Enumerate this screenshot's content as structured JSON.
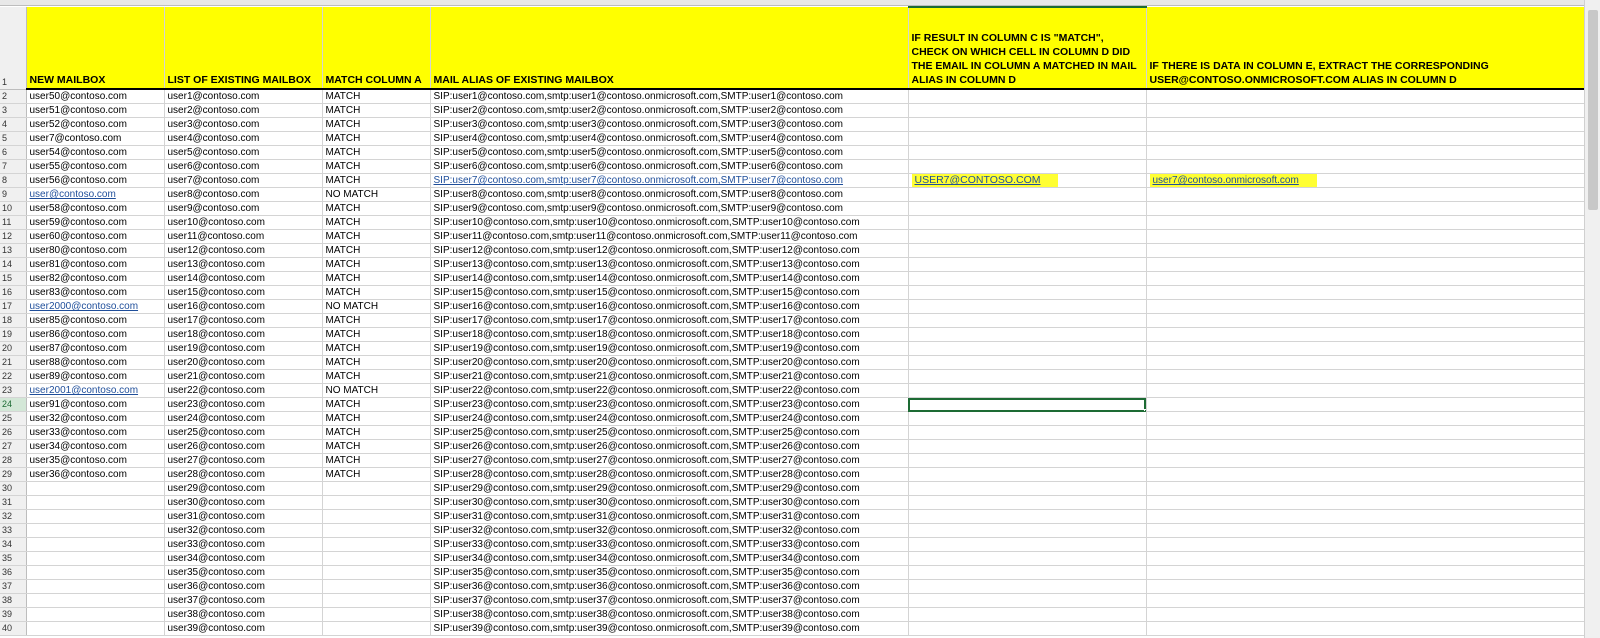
{
  "headers": {
    "a": "NEW MAILBOX",
    "b": "LIST OF EXISTING MAILBOX",
    "c": "MATCH COLUMN A",
    "d": "MAIL ALIAS OF EXISTING MAILBOX",
    "e": "IF RESULT IN COLUMN C IS \"MATCH\", CHECK ON WHICH CELL IN COLUMN D DID THE EMAIL IN COLUMN A MATCHED IN MAIL ALIAS IN COLUMN D",
    "f": "IF THERE IS DATA IN COLUMN E, EXTRACT THE CORRESPONDING USER@CONTOSO.ONMICROSOFT.COM ALIAS IN COLUMN D"
  },
  "rows": [
    {
      "n": "2",
      "a": "user50@contoso.com",
      "b": "user1@contoso.com",
      "c": "MATCH",
      "d": "SIP:user1@contoso.com,smtp:user1@contoso.onmicrosoft.com,SMTP:user1@contoso.com",
      "e": "",
      "f": ""
    },
    {
      "n": "3",
      "a": "user51@contoso.com",
      "b": "user2@contoso.com",
      "c": "MATCH",
      "d": "SIP:user2@contoso.com,smtp:user2@contoso.onmicrosoft.com,SMTP:user2@contoso.com",
      "e": "",
      "f": ""
    },
    {
      "n": "4",
      "a": "user52@contoso.com",
      "b": "user3@contoso.com",
      "c": "MATCH",
      "d": "SIP:user3@contoso.com,smtp:user3@contoso.onmicrosoft.com,SMTP:user3@contoso.com",
      "e": "",
      "f": ""
    },
    {
      "n": "5",
      "a": "user7@contoso.com",
      "b": "user4@contoso.com",
      "c": "MATCH",
      "d": "SIP:user4@contoso.com,smtp:user4@contoso.onmicrosoft.com,SMTP:user4@contoso.com",
      "e": "",
      "f": ""
    },
    {
      "n": "6",
      "a": "user54@contoso.com",
      "b": "user5@contoso.com",
      "c": "MATCH",
      "d": "SIP:user5@contoso.com,smtp:user5@contoso.onmicrosoft.com,SMTP:user5@contoso.com",
      "e": "",
      "f": ""
    },
    {
      "n": "7",
      "a": "user55@contoso.com",
      "b": "user6@contoso.com",
      "c": "MATCH",
      "d": "SIP:user6@contoso.com,smtp:user6@contoso.onmicrosoft.com,SMTP:user6@contoso.com",
      "e": "",
      "f": ""
    },
    {
      "n": "8",
      "a": "user56@contoso.com",
      "b": "user7@contoso.com",
      "c": "MATCH",
      "d": "SIP:user7@contoso.com,smtp:user7@contoso.onmicrosoft.com,SMTP:user7@contoso.com",
      "e": "USER7@CONTOSO.COM",
      "f": "user7@contoso.onmicrosoft.com"
    },
    {
      "n": "9",
      "a": "user@contoso.com",
      "b": "user8@contoso.com",
      "c": "NO MATCH",
      "d": "SIP:user8@contoso.com,smtp:user8@contoso.onmicrosoft.com,SMTP:user8@contoso.com",
      "e": "",
      "f": ""
    },
    {
      "n": "10",
      "a": "user58@contoso.com",
      "b": "user9@contoso.com",
      "c": "MATCH",
      "d": "SIP:user9@contoso.com,smtp:user9@contoso.onmicrosoft.com,SMTP:user9@contoso.com",
      "e": "",
      "f": ""
    },
    {
      "n": "11",
      "a": "user59@contoso.com",
      "b": "user10@contoso.com",
      "c": "MATCH",
      "d": "SIP:user10@contoso.com,smtp:user10@contoso.onmicrosoft.com,SMTP:user10@contoso.com",
      "e": "",
      "f": ""
    },
    {
      "n": "12",
      "a": "user60@contoso.com",
      "b": "user11@contoso.com",
      "c": "MATCH",
      "d": "SIP:user11@contoso.com,smtp:user11@contoso.onmicrosoft.com,SMTP:user11@contoso.com",
      "e": "",
      "f": ""
    },
    {
      "n": "13",
      "a": "user80@contoso.com",
      "b": "user12@contoso.com",
      "c": "MATCH",
      "d": "SIP:user12@contoso.com,smtp:user12@contoso.onmicrosoft.com,SMTP:user12@contoso.com",
      "e": "",
      "f": ""
    },
    {
      "n": "14",
      "a": "user81@contoso.com",
      "b": "user13@contoso.com",
      "c": "MATCH",
      "d": "SIP:user13@contoso.com,smtp:user13@contoso.onmicrosoft.com,SMTP:user13@contoso.com",
      "e": "",
      "f": ""
    },
    {
      "n": "15",
      "a": "user82@contoso.com",
      "b": "user14@contoso.com",
      "c": "MATCH",
      "d": "SIP:user14@contoso.com,smtp:user14@contoso.onmicrosoft.com,SMTP:user14@contoso.com",
      "e": "",
      "f": ""
    },
    {
      "n": "16",
      "a": "user83@contoso.com",
      "b": "user15@contoso.com",
      "c": "MATCH",
      "d": "SIP:user15@contoso.com,smtp:user15@contoso.onmicrosoft.com,SMTP:user15@contoso.com",
      "e": "",
      "f": ""
    },
    {
      "n": "17",
      "a": "user2000@contoso.com",
      "b": "user16@contoso.com",
      "c": "NO MATCH",
      "d": "SIP:user16@contoso.com,smtp:user16@contoso.onmicrosoft.com,SMTP:user16@contoso.com",
      "e": "",
      "f": ""
    },
    {
      "n": "18",
      "a": "user85@contoso.com",
      "b": "user17@contoso.com",
      "c": "MATCH",
      "d": "SIP:user17@contoso.com,smtp:user17@contoso.onmicrosoft.com,SMTP:user17@contoso.com",
      "e": "",
      "f": ""
    },
    {
      "n": "19",
      "a": "user86@contoso.com",
      "b": "user18@contoso.com",
      "c": "MATCH",
      "d": "SIP:user18@contoso.com,smtp:user18@contoso.onmicrosoft.com,SMTP:user18@contoso.com",
      "e": "",
      "f": ""
    },
    {
      "n": "20",
      "a": "user87@contoso.com",
      "b": "user19@contoso.com",
      "c": "MATCH",
      "d": "SIP:user19@contoso.com,smtp:user19@contoso.onmicrosoft.com,SMTP:user19@contoso.com",
      "e": "",
      "f": ""
    },
    {
      "n": "21",
      "a": "user88@contoso.com",
      "b": "user20@contoso.com",
      "c": "MATCH",
      "d": "SIP:user20@contoso.com,smtp:user20@contoso.onmicrosoft.com,SMTP:user20@contoso.com",
      "e": "",
      "f": ""
    },
    {
      "n": "22",
      "a": "user89@contoso.com",
      "b": "user21@contoso.com",
      "c": "MATCH",
      "d": "SIP:user21@contoso.com,smtp:user21@contoso.onmicrosoft.com,SMTP:user21@contoso.com",
      "e": "",
      "f": ""
    },
    {
      "n": "23",
      "a": "user2001@contoso.com",
      "b": "user22@contoso.com",
      "c": "NO MATCH",
      "d": "SIP:user22@contoso.com,smtp:user22@contoso.onmicrosoft.com,SMTP:user22@contoso.com",
      "e": "",
      "f": ""
    },
    {
      "n": "24",
      "a": "user91@contoso.com",
      "b": "user23@contoso.com",
      "c": "MATCH",
      "d": "SIP:user23@contoso.com,smtp:user23@contoso.onmicrosoft.com,SMTP:user23@contoso.com",
      "e": "",
      "f": ""
    },
    {
      "n": "25",
      "a": "user32@contoso.com",
      "b": "user24@contoso.com",
      "c": "MATCH",
      "d": "SIP:user24@contoso.com,smtp:user24@contoso.onmicrosoft.com,SMTP:user24@contoso.com",
      "e": "",
      "f": ""
    },
    {
      "n": "26",
      "a": "user33@contoso.com",
      "b": "user25@contoso.com",
      "c": "MATCH",
      "d": "SIP:user25@contoso.com,smtp:user25@contoso.onmicrosoft.com,SMTP:user25@contoso.com",
      "e": "",
      "f": ""
    },
    {
      "n": "27",
      "a": "user34@contoso.com",
      "b": "user26@contoso.com",
      "c": "MATCH",
      "d": "SIP:user26@contoso.com,smtp:user26@contoso.onmicrosoft.com,SMTP:user26@contoso.com",
      "e": "",
      "f": ""
    },
    {
      "n": "28",
      "a": "user35@contoso.com",
      "b": "user27@contoso.com",
      "c": "MATCH",
      "d": "SIP:user27@contoso.com,smtp:user27@contoso.onmicrosoft.com,SMTP:user27@contoso.com",
      "e": "",
      "f": ""
    },
    {
      "n": "29",
      "a": "user36@contoso.com",
      "b": "user28@contoso.com",
      "c": "MATCH",
      "d": "SIP:user28@contoso.com,smtp:user28@contoso.onmicrosoft.com,SMTP:user28@contoso.com",
      "e": "",
      "f": ""
    },
    {
      "n": "30",
      "a": "",
      "b": "user29@contoso.com",
      "c": "",
      "d": "SIP:user29@contoso.com,smtp:user29@contoso.onmicrosoft.com,SMTP:user29@contoso.com",
      "e": "",
      "f": ""
    },
    {
      "n": "31",
      "a": "",
      "b": "user30@contoso.com",
      "c": "",
      "d": "SIP:user30@contoso.com,smtp:user30@contoso.onmicrosoft.com,SMTP:user30@contoso.com",
      "e": "",
      "f": ""
    },
    {
      "n": "32",
      "a": "",
      "b": "user31@contoso.com",
      "c": "",
      "d": "SIP:user31@contoso.com,smtp:user31@contoso.onmicrosoft.com,SMTP:user31@contoso.com",
      "e": "",
      "f": ""
    },
    {
      "n": "33",
      "a": "",
      "b": "user32@contoso.com",
      "c": "",
      "d": "SIP:user32@contoso.com,smtp:user32@contoso.onmicrosoft.com,SMTP:user32@contoso.com",
      "e": "",
      "f": ""
    },
    {
      "n": "34",
      "a": "",
      "b": "user33@contoso.com",
      "c": "",
      "d": "SIP:user33@contoso.com,smtp:user33@contoso.onmicrosoft.com,SMTP:user33@contoso.com",
      "e": "",
      "f": ""
    },
    {
      "n": "35",
      "a": "",
      "b": "user34@contoso.com",
      "c": "",
      "d": "SIP:user34@contoso.com,smtp:user34@contoso.onmicrosoft.com,SMTP:user34@contoso.com",
      "e": "",
      "f": ""
    },
    {
      "n": "36",
      "a": "",
      "b": "user35@contoso.com",
      "c": "",
      "d": "SIP:user35@contoso.com,smtp:user35@contoso.onmicrosoft.com,SMTP:user35@contoso.com",
      "e": "",
      "f": ""
    },
    {
      "n": "37",
      "a": "",
      "b": "user36@contoso.com",
      "c": "",
      "d": "SIP:user36@contoso.com,smtp:user36@contoso.onmicrosoft.com,SMTP:user36@contoso.com",
      "e": "",
      "f": ""
    },
    {
      "n": "38",
      "a": "",
      "b": "user37@contoso.com",
      "c": "",
      "d": "SIP:user37@contoso.com,smtp:user37@contoso.onmicrosoft.com,SMTP:user37@contoso.com",
      "e": "",
      "f": ""
    },
    {
      "n": "39",
      "a": "",
      "b": "user38@contoso.com",
      "c": "",
      "d": "SIP:user38@contoso.com,smtp:user38@contoso.onmicrosoft.com,SMTP:user38@contoso.com",
      "e": "",
      "f": ""
    },
    {
      "n": "40",
      "a": "",
      "b": "user39@contoso.com",
      "c": "",
      "d": "SIP:user39@contoso.com,smtp:user39@contoso.onmicrosoft.com,SMTP:user39@contoso.com",
      "e": "",
      "f": ""
    }
  ]
}
